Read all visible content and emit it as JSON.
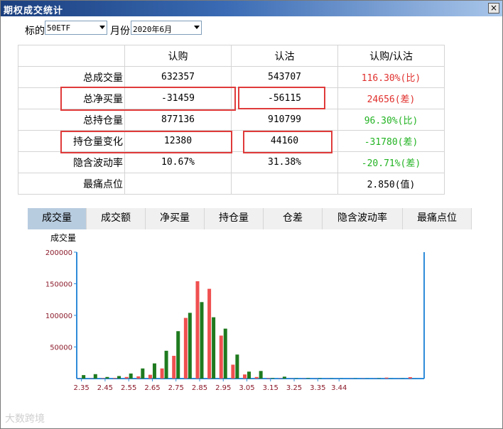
{
  "window": {
    "title": "期权成交统计",
    "close_label": "×"
  },
  "filters": {
    "underlying_label": "标的",
    "underlying_value": "50ETF",
    "month_label": "月份",
    "month_value": "2020年6月"
  },
  "table": {
    "headers": [
      "",
      "认购",
      "认沽",
      "认购/认沽"
    ],
    "rows": [
      {
        "label": "总成交量",
        "call": "632357",
        "put": "543707",
        "ratio": "116.30%(比)",
        "ratio_color": "#e0302d"
      },
      {
        "label": "总净买量",
        "call": "-31459",
        "put": "-56115",
        "ratio": "24656(差)",
        "ratio_color": "#e0302d"
      },
      {
        "label": "总持仓量",
        "call": "877136",
        "put": "910799",
        "ratio": "96.30%(比)",
        "ratio_color": "#22b322"
      },
      {
        "label": "持仓量变化",
        "call": "12380",
        "put": "44160",
        "ratio": "-31780(差)",
        "ratio_color": "#22b322"
      },
      {
        "label": "隐含波动率",
        "call": "10.67%",
        "put": "31.38%",
        "ratio": "-20.71%(差)",
        "ratio_color": "#22b322"
      },
      {
        "label": "最痛点位",
        "call": "",
        "put": "",
        "ratio": "2.850(值)",
        "ratio_color": "#000000"
      }
    ]
  },
  "tabs": [
    "成交量",
    "成交额",
    "净买量",
    "持仓量",
    "仓差",
    "隐含波动率",
    "最痛点位"
  ],
  "active_tab": 0,
  "watermark": "大数跨境",
  "colors": {
    "call": "#f05050",
    "put": "#1f7a1f",
    "axis": "#2e8bd8",
    "tick_label": "#8b1a2a",
    "highlight": "#e03a3a"
  },
  "chart_data": {
    "type": "bar",
    "ylabel": "成交量",
    "ylim": [
      0,
      200000
    ],
    "yticks": [
      50000,
      100000,
      150000,
      200000
    ],
    "xlim": [
      2.33,
      3.8
    ],
    "xticks": [
      "2.35",
      "2.45",
      "2.55",
      "2.65",
      "2.75",
      "2.85",
      "2.95",
      "3.05",
      "3.15",
      "3.25",
      "3.35",
      "3.44"
    ],
    "strikes": [
      2.35,
      2.4,
      2.45,
      2.5,
      2.55,
      2.6,
      2.65,
      2.7,
      2.75,
      2.8,
      2.85,
      2.9,
      2.95,
      3.0,
      3.05,
      3.1,
      3.15,
      3.2,
      3.25,
      3.3,
      3.35,
      3.4,
      3.44,
      3.5,
      3.55,
      3.6,
      3.65,
      3.7,
      3.75
    ],
    "series": [
      {
        "key": "call",
        "values": [
          200,
          400,
          700,
          1000,
          2500,
          3500,
          6000,
          16000,
          36000,
          96000,
          154000,
          142000,
          68000,
          22000,
          6500,
          2500,
          800,
          500,
          200,
          300,
          200,
          200,
          100,
          200,
          300,
          200,
          1500,
          200,
          2200
        ]
      },
      {
        "key": "put",
        "values": [
          5500,
          7000,
          2500,
          4000,
          8000,
          16000,
          24000,
          44000,
          75000,
          104000,
          121000,
          97000,
          79000,
          38000,
          11000,
          12000,
          900,
          3000,
          500,
          800,
          600,
          300,
          200,
          300,
          200,
          500,
          200,
          300,
          100
        ]
      }
    ]
  }
}
